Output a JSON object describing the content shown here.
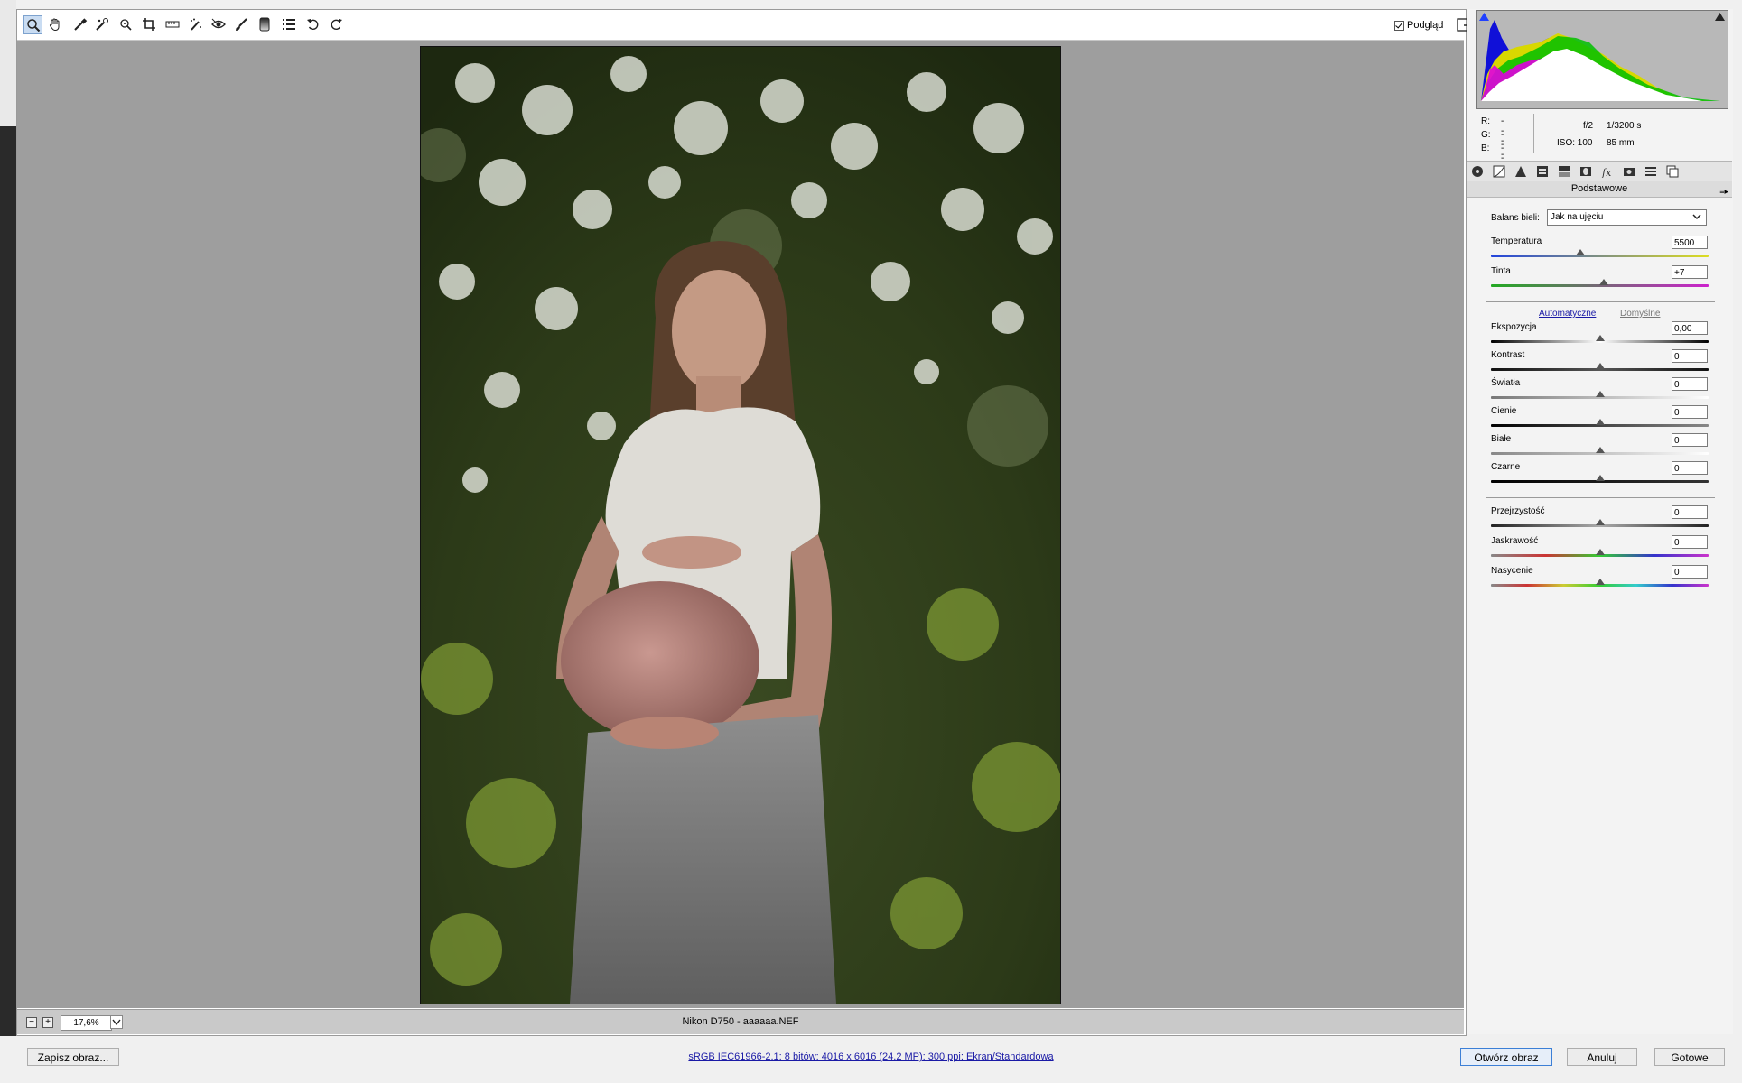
{
  "toolbar": {
    "tools": [
      "zoom-icon",
      "hand-icon",
      "white-balance-icon",
      "color-sampler-icon",
      "targeted-adjustment-icon",
      "crop-icon",
      "straighten-icon",
      "spot-removal-icon",
      "red-eye-icon",
      "adjustment-brush-icon",
      "graduated-filter-icon",
      "preferences-icon",
      "rotate-left-icon",
      "rotate-right-icon"
    ],
    "preview_label": "Podgląd"
  },
  "status": {
    "zoom_value": "17,6%",
    "file_info": "Nikon D750  -  aaaaaa.NEF"
  },
  "rgb": {
    "r_label": "R:",
    "r_value": "---",
    "g_label": "G:",
    "g_value": "---",
    "b_label": "B:",
    "b_value": "---"
  },
  "exif": {
    "aperture": "f/2",
    "shutter": "1/3200 s",
    "iso": "ISO: 100",
    "focal": "85 mm"
  },
  "panel": {
    "title": "Podstawowe",
    "tabs": [
      "basic-tab-icon",
      "tone-curve-tab-icon",
      "detail-tab-icon",
      "hsl-tab-icon",
      "split-toning-tab-icon",
      "lens-tab-icon",
      "effects-tab-icon",
      "camera-calibration-tab-icon",
      "presets-tab-icon",
      "snapshots-tab-icon"
    ],
    "wb_label": "Balans bieli:",
    "wb_value": "Jak na ujęciu",
    "auto_link": "Automatyczne",
    "default_link": "Domyślne",
    "sliders": [
      {
        "label": "Temperatura",
        "value": "5500"
      },
      {
        "label": "Tinta",
        "value": "+7"
      },
      {
        "label": "Ekspozycja",
        "value": "0,00"
      },
      {
        "label": "Kontrast",
        "value": "0"
      },
      {
        "label": "Światła",
        "value": "0"
      },
      {
        "label": "Cienie",
        "value": "0"
      },
      {
        "label": "Białe",
        "value": "0"
      },
      {
        "label": "Czarne",
        "value": "0"
      },
      {
        "label": "Przejrzystość",
        "value": "0"
      },
      {
        "label": "Jaskrawość",
        "value": "0"
      },
      {
        "label": "Nasycenie",
        "value": "0"
      }
    ]
  },
  "bottom": {
    "save_label": "Zapisz obraz...",
    "workflow": "sRGB IEC61966-2.1; 8 bitów; 4016 x 6016 (24,2 MP); 300 ppi; Ekran/Standardowa",
    "open_label": "Otwórz obraz",
    "cancel_label": "Anuluj",
    "done_label": "Gotowe"
  },
  "colors": {
    "canvas_bg": "#9e9e9e",
    "accent": "#3c7fd6",
    "link": "#1a1aa6"
  }
}
